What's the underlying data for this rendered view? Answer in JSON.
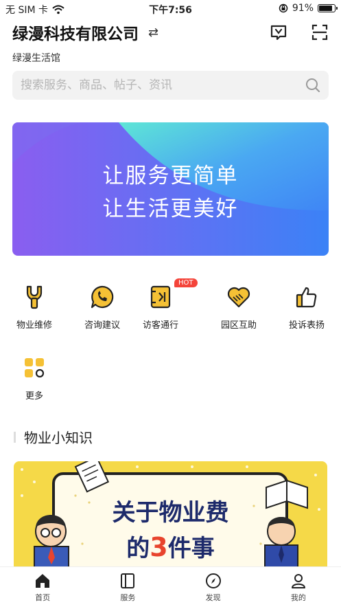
{
  "status_bar": {
    "carrier": "无 SIM 卡",
    "time": "下午7:56",
    "battery": "91%",
    "battery_level": 0.91,
    "icons": [
      "wifi-icon",
      "orientation-lock-icon",
      "battery-icon"
    ]
  },
  "header": {
    "company": "绿漫科技有限公司",
    "subtitle": "绿漫生活馆",
    "icons": [
      "swap-icon",
      "message-icon",
      "scan-icon"
    ]
  },
  "search": {
    "placeholder": "搜索服务、商品、帖子、资讯"
  },
  "banner": {
    "line1": "让服务更简单",
    "line2": "让生活更美好"
  },
  "services": [
    {
      "label": "物业维修",
      "icon": "wrench-icon"
    },
    {
      "label": "咨询建议",
      "icon": "chat-phone-icon"
    },
    {
      "label": "访客通行",
      "icon": "visitor-pass-icon",
      "badge": "HOT"
    },
    {
      "label": "园区互助",
      "icon": "handshake-heart-icon"
    },
    {
      "label": "投诉表扬",
      "icon": "thumbs-up-icon"
    },
    {
      "label": "更多",
      "icon": "grid-more-icon"
    }
  ],
  "section": {
    "title": "物业小知识"
  },
  "article": {
    "line1": "关于物业费",
    "line2_prefix": "的",
    "line2_num": "3",
    "line2_suffix": "件事"
  },
  "tabbar": [
    {
      "label": "首页",
      "icon": "home-icon",
      "active": true
    },
    {
      "label": "服务",
      "icon": "book-icon"
    },
    {
      "label": "发现",
      "icon": "compass-icon"
    },
    {
      "label": "我的",
      "icon": "user-icon"
    }
  ],
  "colors": {
    "accent_yellow": "#f5c135",
    "banner_blue": "#3f86f5",
    "banner_purple": "#7b5cf0",
    "hot_red": "#f4443a"
  }
}
